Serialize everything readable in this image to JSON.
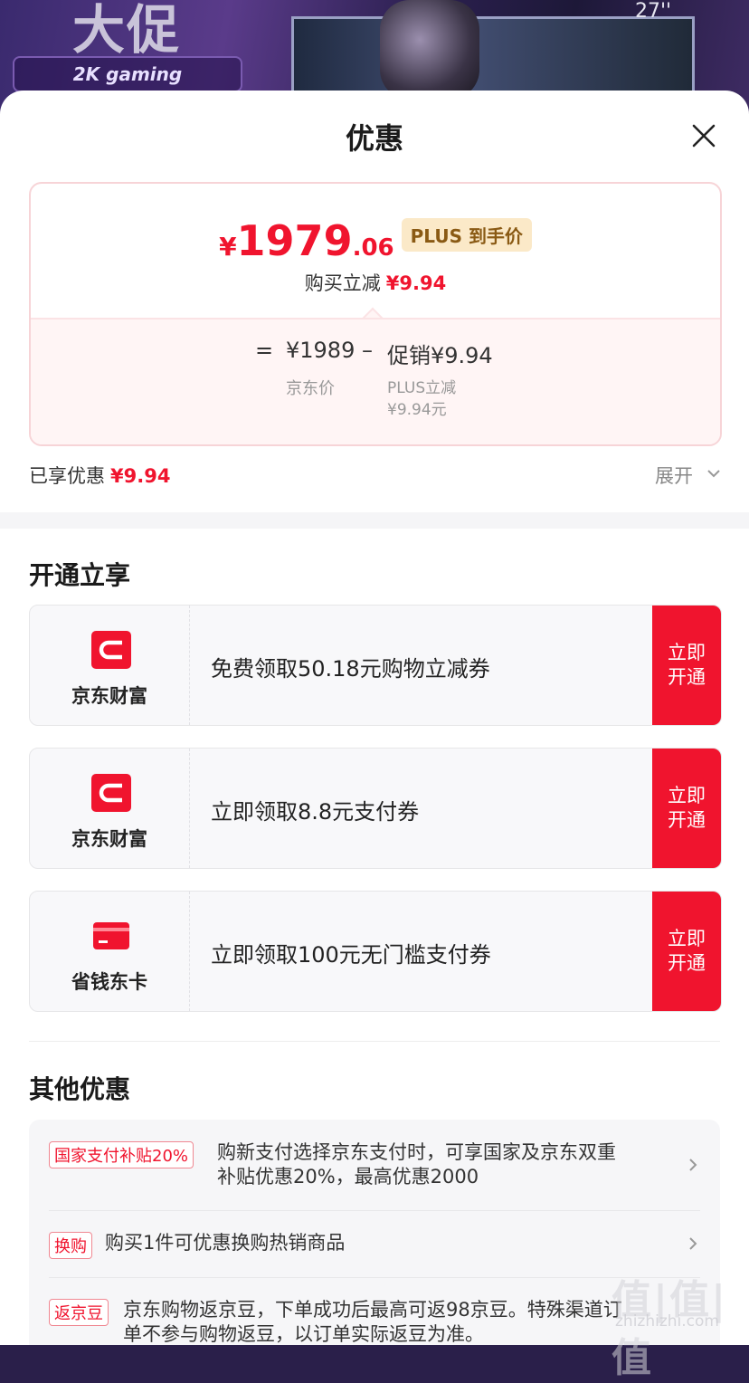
{
  "banner": {
    "headline": "大促",
    "tag": "2K gaming",
    "screen_size": "27''"
  },
  "sheet": {
    "title": "优惠"
  },
  "price": {
    "yen": "¥",
    "integer": "1979",
    "decimal": ".06",
    "plus_tag": "PLUS 到手价",
    "reduce_label": "购买立减",
    "reduce_amount": "¥9.94",
    "calc": {
      "equals": "=",
      "jd_price": "¥1989",
      "minus": "–",
      "promo": "促销¥9.94",
      "jd_label": "京东价",
      "promo_label_1": "PLUS立减",
      "promo_label_2": "¥9.94元"
    }
  },
  "enjoyed": {
    "label": "已享优惠",
    "amount": "¥9.94",
    "expand_label": "展开"
  },
  "open_section": {
    "title": "开通立享",
    "offers": [
      {
        "name": "京东财富",
        "icon": "jd-finance-icon",
        "desc": "免费领取50.18元购物立减券",
        "button": "立即\n开通"
      },
      {
        "name": "京东财富",
        "icon": "jd-finance-icon",
        "desc": "立即领取8.8元支付券",
        "button": "立即\n开通"
      },
      {
        "name": "省钱东卡",
        "icon": "saving-card-icon",
        "desc": "立即领取100元无门槛支付券",
        "button": "立即\n开通"
      }
    ]
  },
  "other_section": {
    "title": "其他优惠",
    "items": [
      {
        "tag": "国家支付补贴20%",
        "line1": "购新支付选择京东支付时，可享国家及京东双重",
        "line2": "补贴优惠20%，最高优惠2000"
      },
      {
        "tag": "换购",
        "line1": "购买1件可优惠换购热销商品",
        "line2": ""
      },
      {
        "tag": "返京豆",
        "line1": "京东购物返京豆，下单成功后最高可返98京豆。特殊渠道订",
        "line2": "单不参与购物返豆，以订单实际返豆为准。"
      }
    ]
  },
  "watermark": {
    "text": "值|值|值",
    "sub": "zhizhizhi.com"
  },
  "colors": {
    "accent": "#f0142e",
    "plus_bg": "#fbe9c8",
    "plus_text": "#8a5a14"
  }
}
